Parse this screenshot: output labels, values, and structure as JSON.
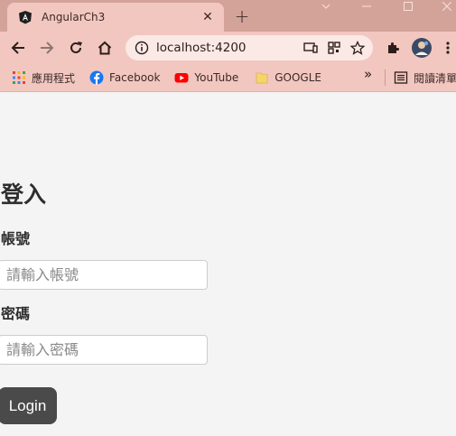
{
  "browser": {
    "tab_title": "AngularCh3",
    "tab_close": "✕",
    "new_tab": "+",
    "url": "localhost:4200",
    "bookmarks": [
      {
        "label": "應用程式",
        "icon": "apps-grid-icon"
      },
      {
        "label": "Facebook",
        "icon": "facebook-icon",
        "color": "#1877f2"
      },
      {
        "label": "YouTube",
        "icon": "youtube-icon",
        "color": "#ff0000"
      },
      {
        "label": "GOOGLE",
        "icon": "folder-icon",
        "color": "#f7d46a"
      }
    ],
    "more_bookmarks": "»",
    "reading_list": "閱讀清單",
    "accent": "#f2c7c0",
    "tabstrip_color": "#d3a39a"
  },
  "login": {
    "heading": "登入",
    "username_label": "帳號",
    "username_placeholder": "請輸入帳號",
    "password_label": "密碼",
    "password_placeholder": "請輸入密碼",
    "submit_label": "Login",
    "button_color": "#4a4a4a"
  }
}
